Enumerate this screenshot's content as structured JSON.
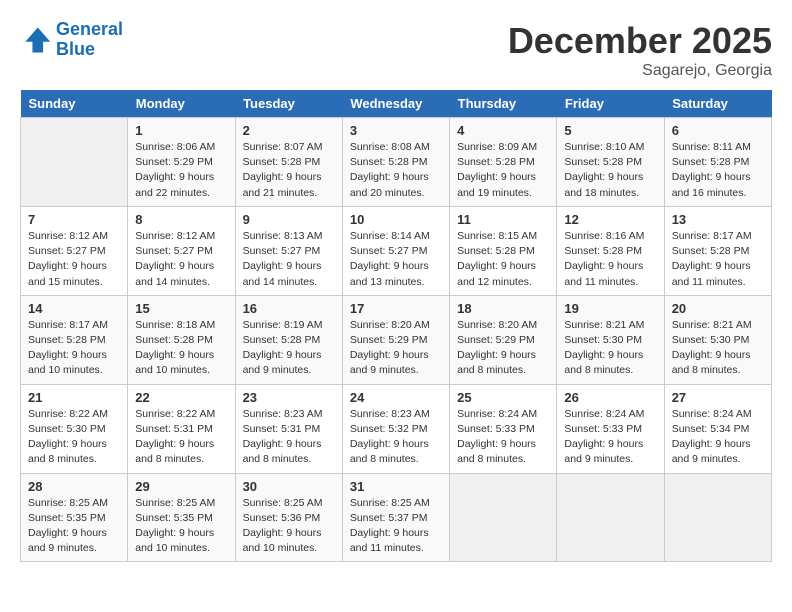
{
  "logo": {
    "line1": "General",
    "line2": "Blue"
  },
  "title": "December 2025",
  "subtitle": "Sagarejo, Georgia",
  "days_of_week": [
    "Sunday",
    "Monday",
    "Tuesday",
    "Wednesday",
    "Thursday",
    "Friday",
    "Saturday"
  ],
  "weeks": [
    [
      {
        "num": "",
        "info": ""
      },
      {
        "num": "1",
        "info": "Sunrise: 8:06 AM\nSunset: 5:29 PM\nDaylight: 9 hours\nand 22 minutes."
      },
      {
        "num": "2",
        "info": "Sunrise: 8:07 AM\nSunset: 5:28 PM\nDaylight: 9 hours\nand 21 minutes."
      },
      {
        "num": "3",
        "info": "Sunrise: 8:08 AM\nSunset: 5:28 PM\nDaylight: 9 hours\nand 20 minutes."
      },
      {
        "num": "4",
        "info": "Sunrise: 8:09 AM\nSunset: 5:28 PM\nDaylight: 9 hours\nand 19 minutes."
      },
      {
        "num": "5",
        "info": "Sunrise: 8:10 AM\nSunset: 5:28 PM\nDaylight: 9 hours\nand 18 minutes."
      },
      {
        "num": "6",
        "info": "Sunrise: 8:11 AM\nSunset: 5:28 PM\nDaylight: 9 hours\nand 16 minutes."
      }
    ],
    [
      {
        "num": "7",
        "info": "Sunrise: 8:12 AM\nSunset: 5:27 PM\nDaylight: 9 hours\nand 15 minutes."
      },
      {
        "num": "8",
        "info": "Sunrise: 8:12 AM\nSunset: 5:27 PM\nDaylight: 9 hours\nand 14 minutes."
      },
      {
        "num": "9",
        "info": "Sunrise: 8:13 AM\nSunset: 5:27 PM\nDaylight: 9 hours\nand 14 minutes."
      },
      {
        "num": "10",
        "info": "Sunrise: 8:14 AM\nSunset: 5:27 PM\nDaylight: 9 hours\nand 13 minutes."
      },
      {
        "num": "11",
        "info": "Sunrise: 8:15 AM\nSunset: 5:28 PM\nDaylight: 9 hours\nand 12 minutes."
      },
      {
        "num": "12",
        "info": "Sunrise: 8:16 AM\nSunset: 5:28 PM\nDaylight: 9 hours\nand 11 minutes."
      },
      {
        "num": "13",
        "info": "Sunrise: 8:17 AM\nSunset: 5:28 PM\nDaylight: 9 hours\nand 11 minutes."
      }
    ],
    [
      {
        "num": "14",
        "info": "Sunrise: 8:17 AM\nSunset: 5:28 PM\nDaylight: 9 hours\nand 10 minutes."
      },
      {
        "num": "15",
        "info": "Sunrise: 8:18 AM\nSunset: 5:28 PM\nDaylight: 9 hours\nand 10 minutes."
      },
      {
        "num": "16",
        "info": "Sunrise: 8:19 AM\nSunset: 5:28 PM\nDaylight: 9 hours\nand 9 minutes."
      },
      {
        "num": "17",
        "info": "Sunrise: 8:20 AM\nSunset: 5:29 PM\nDaylight: 9 hours\nand 9 minutes."
      },
      {
        "num": "18",
        "info": "Sunrise: 8:20 AM\nSunset: 5:29 PM\nDaylight: 9 hours\nand 8 minutes."
      },
      {
        "num": "19",
        "info": "Sunrise: 8:21 AM\nSunset: 5:30 PM\nDaylight: 9 hours\nand 8 minutes."
      },
      {
        "num": "20",
        "info": "Sunrise: 8:21 AM\nSunset: 5:30 PM\nDaylight: 9 hours\nand 8 minutes."
      }
    ],
    [
      {
        "num": "21",
        "info": "Sunrise: 8:22 AM\nSunset: 5:30 PM\nDaylight: 9 hours\nand 8 minutes."
      },
      {
        "num": "22",
        "info": "Sunrise: 8:22 AM\nSunset: 5:31 PM\nDaylight: 9 hours\nand 8 minutes."
      },
      {
        "num": "23",
        "info": "Sunrise: 8:23 AM\nSunset: 5:31 PM\nDaylight: 9 hours\nand 8 minutes."
      },
      {
        "num": "24",
        "info": "Sunrise: 8:23 AM\nSunset: 5:32 PM\nDaylight: 9 hours\nand 8 minutes."
      },
      {
        "num": "25",
        "info": "Sunrise: 8:24 AM\nSunset: 5:33 PM\nDaylight: 9 hours\nand 8 minutes."
      },
      {
        "num": "26",
        "info": "Sunrise: 8:24 AM\nSunset: 5:33 PM\nDaylight: 9 hours\nand 9 minutes."
      },
      {
        "num": "27",
        "info": "Sunrise: 8:24 AM\nSunset: 5:34 PM\nDaylight: 9 hours\nand 9 minutes."
      }
    ],
    [
      {
        "num": "28",
        "info": "Sunrise: 8:25 AM\nSunset: 5:35 PM\nDaylight: 9 hours\nand 9 minutes."
      },
      {
        "num": "29",
        "info": "Sunrise: 8:25 AM\nSunset: 5:35 PM\nDaylight: 9 hours\nand 10 minutes."
      },
      {
        "num": "30",
        "info": "Sunrise: 8:25 AM\nSunset: 5:36 PM\nDaylight: 9 hours\nand 10 minutes."
      },
      {
        "num": "31",
        "info": "Sunrise: 8:25 AM\nSunset: 5:37 PM\nDaylight: 9 hours\nand 11 minutes."
      },
      {
        "num": "",
        "info": ""
      },
      {
        "num": "",
        "info": ""
      },
      {
        "num": "",
        "info": ""
      }
    ]
  ]
}
